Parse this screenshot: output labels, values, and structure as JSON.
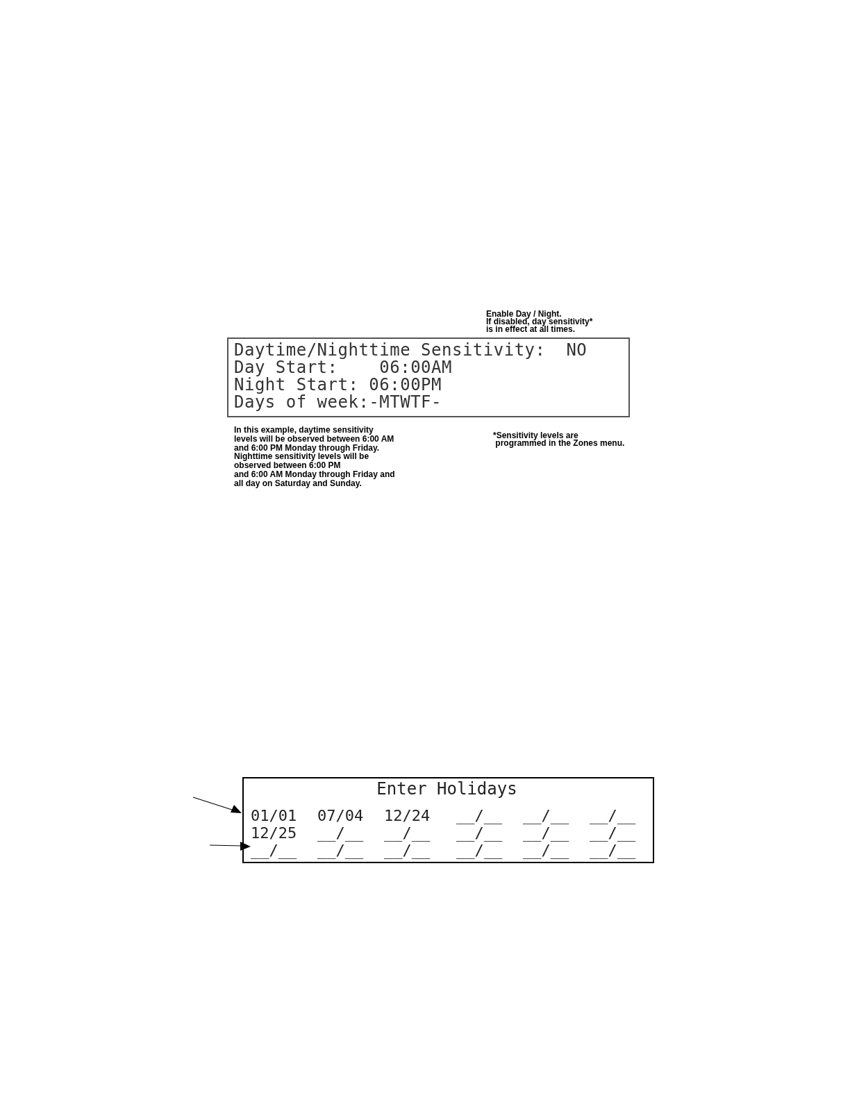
{
  "sensitivity_screen": {
    "annotation_lines": [
      "Enable Day / Night.",
      "If disabled, day sensitivity*",
      "is in effect at all times."
    ],
    "lines": [
      "Daytime/Nighttime Sensitivity:  NO",
      "Day Start:    06:00AM",
      "Night Start: 06:00PM",
      "Days of week:-MTWTF-"
    ],
    "example_lines": [
      "In this example, daytime sensitivity",
      "levels will be observed between 6:00 AM",
      "and 6:00 PM Monday through Friday.",
      "Nighttime sensitivity levels will be",
      "observed between 6:00 PM",
      "and 6:00 AM Monday through Friday and",
      "all day on Saturday and Sunday."
    ],
    "footnote_lines": [
      "*Sensitivity levels are",
      " programmed in the Zones menu."
    ]
  },
  "holidays_screen": {
    "title": "Enter Holidays",
    "slots": [
      "01/01",
      "07/04",
      "12/24",
      "__/__",
      "__/__",
      "__/__",
      "12/25",
      "__/__",
      "__/__",
      "__/__",
      "__/__",
      "__/__",
      "__/__",
      "__/__",
      "__/__",
      "__/__",
      "__/__",
      "__/__"
    ]
  }
}
